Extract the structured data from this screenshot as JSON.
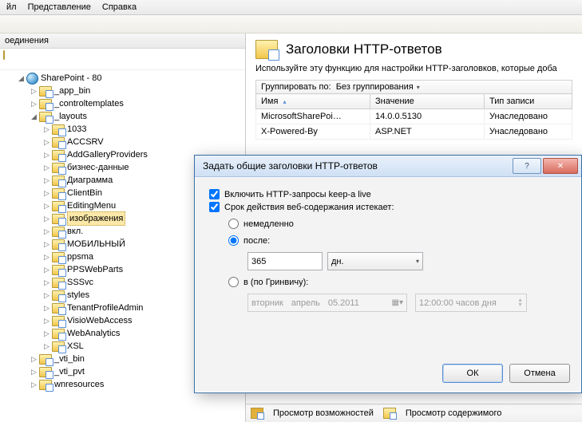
{
  "menu": {
    "items": [
      "йл",
      "Представление",
      "Справка"
    ]
  },
  "left_title": "оединения",
  "tree": {
    "root": "SharePoint - 80",
    "nodes": [
      "_app_bin",
      "_controltemplates",
      "_layouts"
    ],
    "layouts": [
      "1033",
      "ACCSRV",
      "AddGalleryProviders",
      "бизнес-данные",
      "Диаграмма",
      "ClientBin",
      "EditingMenu",
      "изображения",
      "вкл.",
      "МОБИЛЬНЫЙ",
      "ppsma",
      "PPSWebParts",
      "SSSvc",
      "styles",
      "TenantProfileAdmin",
      "VisioWebAccess",
      "WebAnalytics",
      "XSL"
    ],
    "after": [
      "_vti_bin",
      "_vti_pvt",
      "wnresources"
    ]
  },
  "page": {
    "title": "Заголовки HTTP-ответов",
    "desc": "Используйте эту функцию для настройки HTTP-заголовков, которые доба",
    "group_label": "Группировать по:",
    "group_value": "Без группирования",
    "cols": [
      "Имя",
      "Значение",
      "Тип записи"
    ],
    "rows": [
      {
        "n": "MicrosoftSharePoi…",
        "v": "14.0.0.5130",
        "t": "Унаследовано"
      },
      {
        "n": "X-Powered-By",
        "v": "ASP.NET",
        "t": "Унаследовано"
      }
    ],
    "switch": [
      "Просмотр возможностей",
      "Просмотр содержимого"
    ]
  },
  "dialog": {
    "title": "Задать общие заголовки HTTP-ответов",
    "chk1": "Включить HTTP-запросы keep-a live",
    "chk2": "Срок действия веб-содержания истекает:",
    "r1": "немедленно",
    "r2": "после:",
    "r3": "в (по Гринвичу):",
    "after_value": "365",
    "after_unit": "дн.",
    "date": {
      "d": "вторник",
      "m": "апрель",
      "full": "05.2011"
    },
    "time": "12:00:00 часов дня",
    "ok": "ОК",
    "cancel": "Отмена"
  }
}
